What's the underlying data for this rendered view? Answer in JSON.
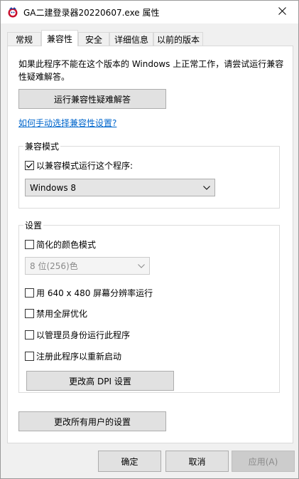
{
  "window": {
    "title": "GA二建登录器20220607.exe 属性",
    "app_icon": "app-icon",
    "close_glyph": "✕"
  },
  "tabs": [
    {
      "label": "常规"
    },
    {
      "label": "兼容性",
      "active": true
    },
    {
      "label": "安全"
    },
    {
      "label": "详细信息"
    },
    {
      "label": "以前的版本"
    }
  ],
  "compat": {
    "intro": "如果此程序不能在这个版本的 Windows 上正常工作，请尝试运行兼容性疑难解答。",
    "troubleshoot_button": "运行兼容性疑难解答",
    "manual_link": "如何手动选择兼容性设置?",
    "mode_group": {
      "label": "兼容模式",
      "checkbox_label": "以兼容模式运行这个程序:",
      "checked": true,
      "selected_os": "Windows 8"
    },
    "settings_group": {
      "label": "设置",
      "reduced_color_label": "简化的颜色模式",
      "color_select": "8 位(256)色",
      "run_640_label": "用 640 x 480 屏幕分辨率运行",
      "disable_fullscreen_label": "禁用全屏优化",
      "run_as_admin_label": "以管理员身份运行此程序",
      "register_restart_label": "注册此程序以重新启动",
      "dpi_button": "更改高 DPI 设置"
    },
    "all_users_button": "更改所有用户的设置"
  },
  "footer": {
    "ok": "确定",
    "cancel": "取消",
    "apply": "应用(A)"
  }
}
